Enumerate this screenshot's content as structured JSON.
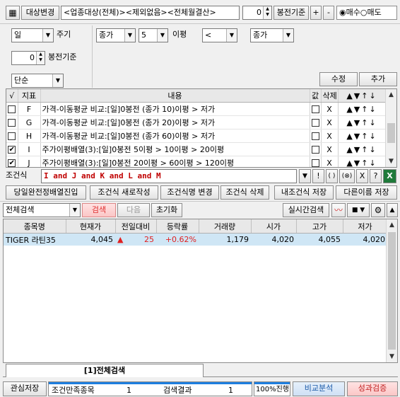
{
  "toolbar": {
    "sector_button": "대상변경",
    "target_text": "<업종대상(전체)><제외없음><전체월결산>",
    "base_value": "0",
    "base_label": "봉전기준",
    "plus": "+",
    "minus": "-",
    "radio_buy": "매수",
    "radio_sell": "매도"
  },
  "settings": {
    "period_value": "일",
    "period_label": "주기",
    "price_value": "종가",
    "ma_value": "5",
    "ma_label": "이평",
    "op_value": "<",
    "target_value": "종가",
    "base_value": "0",
    "base_label": "봉전기준",
    "mode_value": "단순",
    "edit_button": "수정",
    "add_button": "추가"
  },
  "cond_table": {
    "headers": [
      "√",
      "지표",
      "내용",
      "값",
      "삭제"
    ],
    "rows": [
      {
        "checked": false,
        "id": "F",
        "content": "가격-이동평균 비교:[일]0봉전 (종가 10)이평 > 저가",
        "del": "X"
      },
      {
        "checked": false,
        "id": "G",
        "content": "가격-이동평균 비교:[일]0봉전 (종가 20)이평 > 저가",
        "del": "X"
      },
      {
        "checked": false,
        "id": "H",
        "content": "가격-이동평균 비교:[일]0봉전 (종가 60)이평 > 저가",
        "del": "X"
      },
      {
        "checked": true,
        "id": "I",
        "content": "주가이평배열(3):[일]0봉전 5이평 > 10이평 > 20이평",
        "del": "X"
      },
      {
        "checked": true,
        "id": "J",
        "content": "주가이평배열(3):[일]0봉전 20이평 > 60이평 > 120이평",
        "del": "X"
      }
    ],
    "move_icons": "▲▼↑↓"
  },
  "formula": {
    "label": "조건식",
    "text": "I and J and K and L and M",
    "btn_down": "▼",
    "btn_not": "!",
    "btn_paren": "( )",
    "btn_x_circle": "(⊗)",
    "btn_x": "X",
    "btn_help": "?"
  },
  "actions": {
    "a1": "당일완전정배열진입",
    "a2": "조건식 새로작성",
    "a3": "조건식명 변경",
    "a4": "조건식 삭제",
    "a5": "내조건식 저장",
    "a6": "다른이름 저장"
  },
  "search_bar": {
    "scope_value": "전체검색",
    "search_button": "검색",
    "next_button": "다음",
    "reset_button": "초기화",
    "realtime_button": "실시간검색"
  },
  "results": {
    "headers": [
      "종목명",
      "현재가",
      "전일대비",
      "등락률",
      "거래량",
      "시가",
      "고가",
      "저가"
    ],
    "rows": [
      {
        "name": "TIGER 라틴35",
        "price": "4,045",
        "change_icon": "▲",
        "change": "25",
        "rate": "+0.62%",
        "volume": "1,179",
        "open": "4,020",
        "high": "4,055",
        "low": "4,020"
      }
    ]
  },
  "tab": {
    "label": "[1]전체검색"
  },
  "status_bar": {
    "save_button": "관심저장",
    "matched_label": "조건만족종목",
    "matched_value": "1",
    "result_label": "검색결과",
    "result_value": "1",
    "progress_text": "100%진행",
    "progress_fraction": 1.0,
    "compare_button": "비교분석",
    "perf_button": "성과검증"
  },
  "colors": {
    "search_red": "#e03030",
    "formula_red": "#c00000",
    "row_highlight": "#cfe6f5",
    "up_red": "#e02020",
    "progress_blue": "#1e7fe0"
  }
}
